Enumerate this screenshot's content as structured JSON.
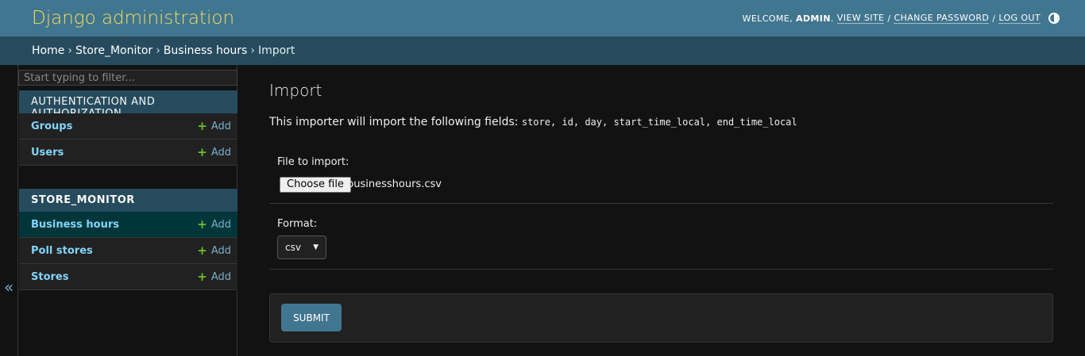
{
  "header": {
    "branding": "Django administration",
    "welcome": "WELCOME,",
    "user": "ADMIN",
    "user_suffix": ".",
    "view_site": "VIEW SITE",
    "change_password": "CHANGE PASSWORD",
    "log_out": "LOG OUT",
    "separator": "/"
  },
  "breadcrumbs": {
    "items": [
      "Home",
      "Store_Monitor",
      "Business hours"
    ],
    "current": "Import",
    "arrow": "›"
  },
  "sidebar": {
    "filter_placeholder": "Start typing to filter...",
    "collapse_glyph": "«",
    "modules": [
      {
        "caption": "AUTHENTICATION AND AUTHORIZATION",
        "models": [
          {
            "name": "Groups",
            "add": "Add"
          },
          {
            "name": "Users",
            "add": "Add"
          }
        ]
      },
      {
        "caption": "STORE_MONITOR",
        "models": [
          {
            "name": "Business hours",
            "add": "Add",
            "active": true
          },
          {
            "name": "Poll stores",
            "add": "Add"
          },
          {
            "name": "Stores",
            "add": "Add"
          }
        ]
      }
    ]
  },
  "main": {
    "title": "Import",
    "intro": "This importer will import the following fields:",
    "fields": "store, id, day, start_time_local, end_time_local",
    "file_label": "File to import:",
    "choose_file": "Choose file",
    "file_name": "businesshours.csv",
    "format_label": "Format:",
    "format_value": "csv",
    "submit": "SUBMIT"
  },
  "colors": {
    "header_bg": "#417690",
    "breadcrumbs_bg": "#264b5d",
    "branding": "#f5dd5d",
    "link": "#81d4fa",
    "add_plus": "#70bf2b",
    "active_row": "#00363a"
  }
}
